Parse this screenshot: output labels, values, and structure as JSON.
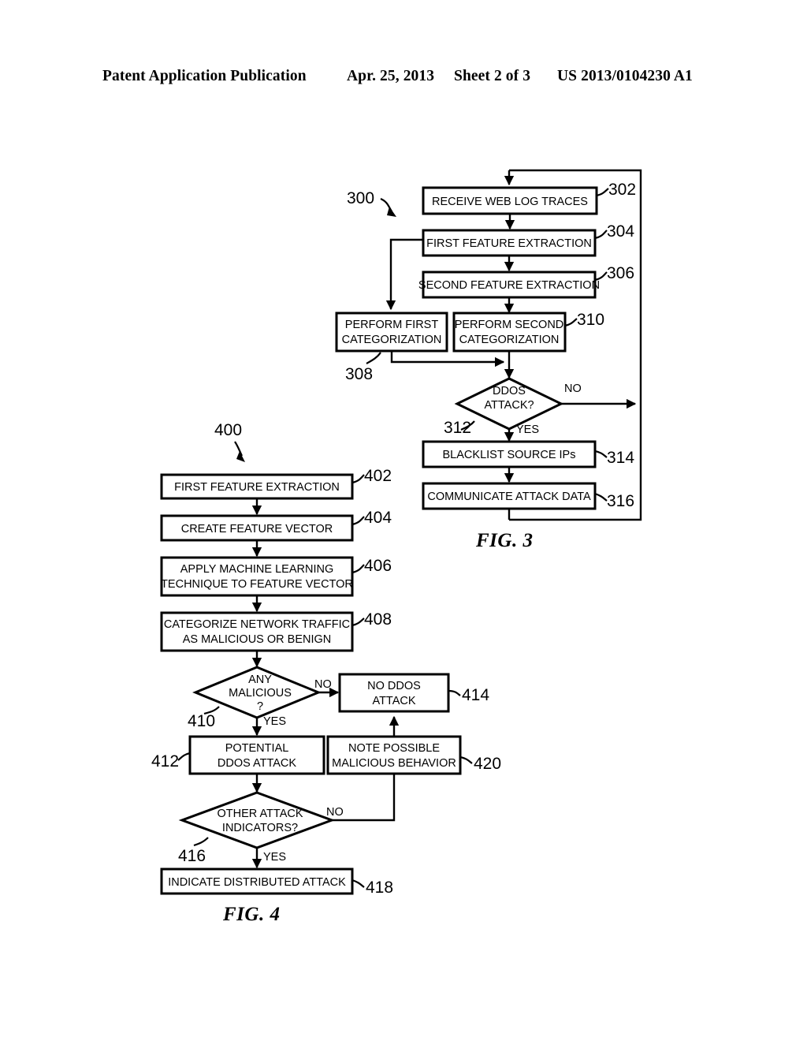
{
  "header": {
    "left": "Patent Application Publication",
    "date": "Apr. 25, 2013",
    "sheet": "Sheet 2 of 3",
    "pub_number": "US 2013/0104230 A1"
  },
  "figures": [
    {
      "caption": "FIG. 3",
      "flow_id": "300",
      "nodes": [
        {
          "ref": "302",
          "type": "process",
          "label_lines": [
            "RECEIVE WEB LOG TRACES"
          ]
        },
        {
          "ref": "304",
          "type": "process",
          "label_lines": [
            "FIRST FEATURE EXTRACTION"
          ]
        },
        {
          "ref": "306",
          "type": "process",
          "label_lines": [
            "SECOND FEATURE EXTRACTION"
          ]
        },
        {
          "ref": "308",
          "type": "process",
          "label_lines": [
            "PERFORM FIRST",
            "CATEGORIZATION"
          ]
        },
        {
          "ref": "310",
          "type": "process",
          "label_lines": [
            "PERFORM SECOND",
            "CATEGORIZATION"
          ]
        },
        {
          "ref": "312",
          "type": "decision",
          "label_lines": [
            "DDOS",
            "ATTACK?"
          ]
        },
        {
          "ref": "314",
          "type": "process",
          "label_lines": [
            "BLACKLIST SOURCE IPs"
          ]
        },
        {
          "ref": "316",
          "type": "process",
          "label_lines": [
            "COMMUNICATE ATTACK DATA"
          ]
        }
      ],
      "edge_labels": {
        "decision_no": "NO",
        "decision_yes": "YES"
      }
    },
    {
      "caption": "FIG. 4",
      "flow_id": "400",
      "nodes": [
        {
          "ref": "402",
          "type": "process",
          "label_lines": [
            "FIRST FEATURE EXTRACTION"
          ]
        },
        {
          "ref": "404",
          "type": "process",
          "label_lines": [
            "CREATE FEATURE VECTOR"
          ]
        },
        {
          "ref": "406",
          "type": "process",
          "label_lines": [
            "APPLY MACHINE LEARNING",
            "TECHNIQUE TO FEATURE VECTOR"
          ]
        },
        {
          "ref": "408",
          "type": "process",
          "label_lines": [
            "CATEGORIZE NETWORK TRAFFIC",
            "AS MALICIOUS OR BENIGN"
          ]
        },
        {
          "ref": "410",
          "type": "decision",
          "label_lines": [
            "ANY",
            "MALICIOUS",
            "?"
          ]
        },
        {
          "ref": "412",
          "type": "process",
          "label_lines": [
            "POTENTIAL",
            "DDOS ATTACK"
          ]
        },
        {
          "ref": "414",
          "type": "process",
          "label_lines": [
            "NO DDOS",
            "ATTACK"
          ]
        },
        {
          "ref": "416",
          "type": "decision",
          "label_lines": [
            "OTHER ATTACK",
            "INDICATORS?"
          ]
        },
        {
          "ref": "418",
          "type": "process",
          "label_lines": [
            "INDICATE DISTRIBUTED ATTACK"
          ]
        },
        {
          "ref": "420",
          "type": "process",
          "label_lines": [
            "NOTE POSSIBLE",
            "MALICIOUS BEHAVIOR"
          ]
        }
      ],
      "edge_labels": {
        "decision_no": "NO",
        "decision_yes": "YES"
      }
    }
  ],
  "colors": {
    "ink": "#000000",
    "paper": "#ffffff"
  }
}
